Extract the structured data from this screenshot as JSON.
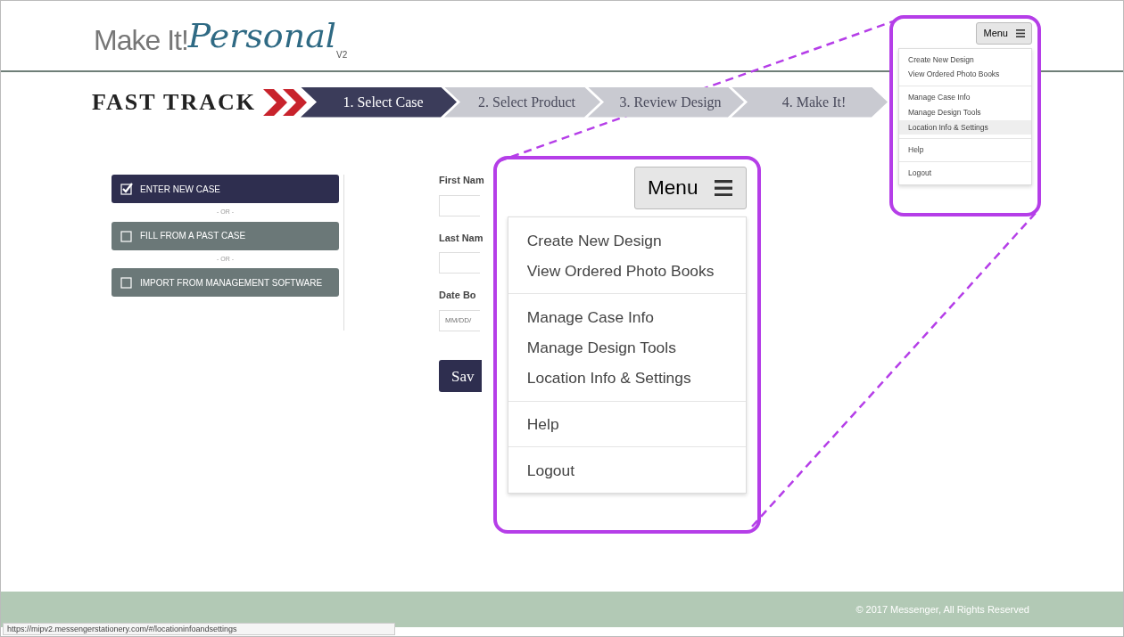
{
  "logo": {
    "plain": "Make It!",
    "script": "Personal",
    "version": "V2"
  },
  "fast_track": {
    "title": "FAST TRACK"
  },
  "steps": [
    {
      "label": "1. Select Case",
      "selected": true
    },
    {
      "label": "2. Select Product",
      "selected": false
    },
    {
      "label": "3. Review Design",
      "selected": false
    },
    {
      "label": "4. Make It!",
      "selected": false
    }
  ],
  "options": [
    {
      "kind": "option",
      "label": "ENTER NEW CASE",
      "checked": true
    },
    {
      "kind": "separator",
      "label": "- OR -"
    },
    {
      "kind": "option",
      "label": "FILL FROM A PAST CASE",
      "checked": false
    },
    {
      "kind": "separator",
      "label": "- OR -"
    },
    {
      "kind": "option",
      "label": "IMPORT FROM MANAGEMENT SOFTWARE",
      "checked": false
    }
  ],
  "form": {
    "fields": [
      {
        "label": "First Nam"
      },
      {
        "label": "Last Nam"
      },
      {
        "label": "Date Bo",
        "placeholder": "MM/DD/"
      }
    ],
    "button": "Sav"
  },
  "menu": {
    "button": "Menu",
    "groups": [
      [
        {
          "label": "Create New Design",
          "selected": false
        },
        {
          "label": "View Ordered Photo Books",
          "selected": false
        }
      ],
      [
        {
          "label": "Manage Case Info",
          "selected": false
        },
        {
          "label": "Manage Design Tools",
          "selected": false
        },
        {
          "label": "Location Info & Settings",
          "selected": true
        }
      ],
      [
        {
          "label": "Help",
          "selected": false
        }
      ],
      [
        {
          "label": "Logout",
          "selected": false
        }
      ]
    ]
  },
  "callout": {
    "button": "Menu",
    "groups": [
      [
        {
          "label": "Create New Design",
          "selected": false
        },
        {
          "label": "View Ordered Photo Books",
          "selected": false
        }
      ],
      [
        {
          "label": "Manage Case Info",
          "selected": false
        },
        {
          "label": "Manage Design Tools",
          "selected": false
        },
        {
          "label": "Location Info & Settings",
          "selected": false
        }
      ],
      [
        {
          "label": "Help",
          "selected": false
        }
      ],
      [
        {
          "label": "Logout",
          "selected": false
        }
      ]
    ]
  },
  "footer": {
    "text": "© 2017 Messenger, All Rights Reserved"
  },
  "status_bar": {
    "url": "https://mipv2.messengerstationery.com/#/locationinfoandsettings"
  }
}
